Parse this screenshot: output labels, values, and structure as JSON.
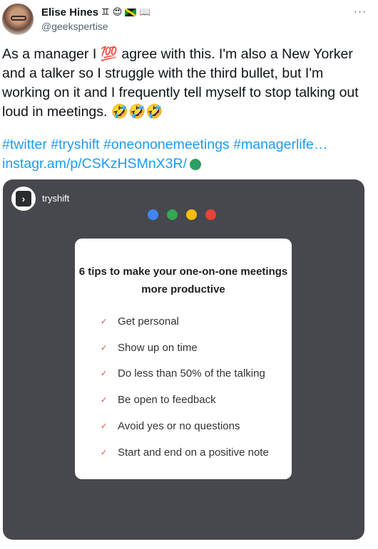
{
  "tweet": {
    "author": {
      "display_name": "Elise Hines",
      "name_emojis": [
        "♊",
        "😍",
        "jamaica-flag",
        "📖"
      ],
      "handle": "@geekspertise"
    },
    "more_icon": "more-horizontal-icon",
    "text": "As a manager I 💯 agree with this. I'm also a New Yorker and a talker so I struggle with the third bullet, but I'm working on it and I frequently tell myself to stop talking out loud in meetings. 🤣🤣🤣",
    "hashtags": [
      "#twitter",
      "#tryshift",
      "#oneononemeetings",
      "#managerlife…"
    ],
    "link": "instagr.am/p/CSKzHSMnX3R/",
    "link_icon": "check-circle-icon"
  },
  "media": {
    "account_name": "tryshift",
    "account_icon": "chevron-right-icon",
    "dot_colors": [
      "#4285f4",
      "#34a853",
      "#fbbc05",
      "#ea4335"
    ],
    "card": {
      "title": "6 tips to make your one-on-one meetings more productive",
      "check_color": "#e0413c",
      "tips": [
        "Get personal",
        "Show up on time",
        "Do less than 50% of the talking",
        "Be open to feedback",
        "Avoid yes or no questions",
        "Start and end on a positive note"
      ]
    }
  },
  "colors": {
    "link": "#1d9bf0",
    "media_background": "#46484d",
    "secondary_text": "#536471"
  }
}
